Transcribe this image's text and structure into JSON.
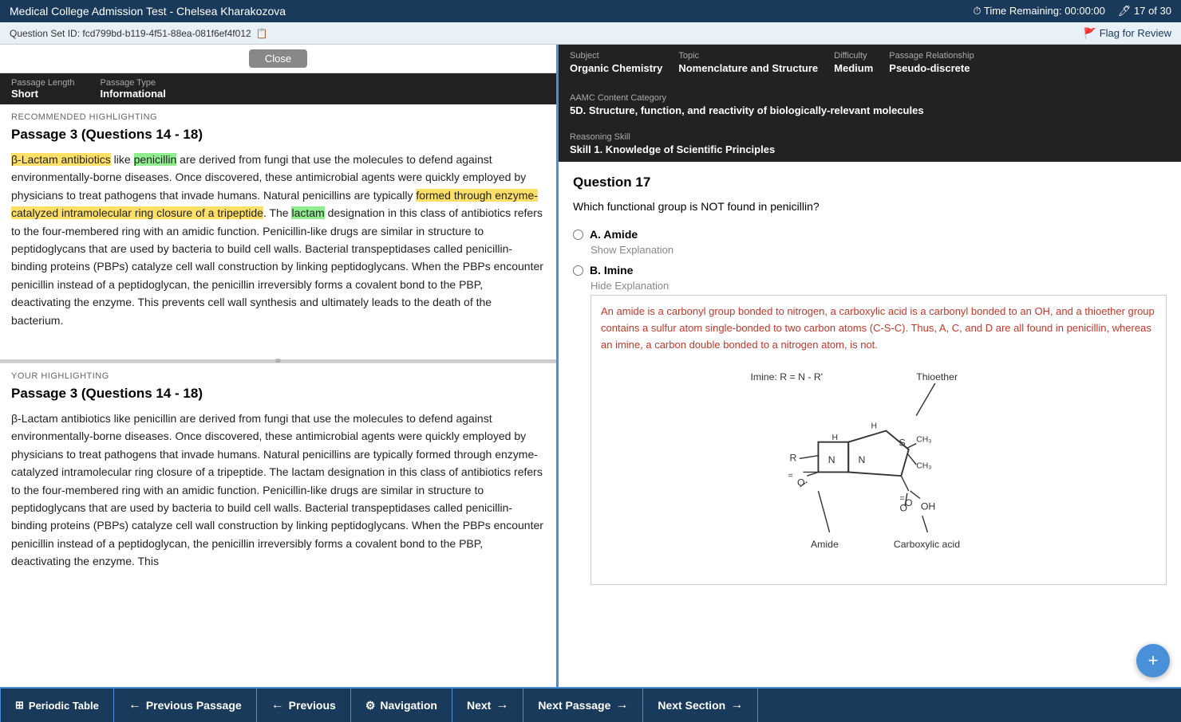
{
  "topBar": {
    "title": "Medical College Admission Test - Chelsea Kharakozova",
    "timeLabel": "Time Remaining:",
    "timeValue": "00:00:00",
    "questionCount": "17 of 30"
  },
  "qsetBar": {
    "idLabel": "Question Set ID: fcd799bd-b119-4f51-88ea-081f6ef4f012",
    "flagLabel": "Flag for Review"
  },
  "closeBtn": "Close",
  "leftMeta": {
    "passageLengthLabel": "Passage Length",
    "passageLengthValue": "Short",
    "passageTypeLabel": "Passage Type",
    "passageTypeValue": "Informational"
  },
  "rightMeta": {
    "subjectLabel": "Subject",
    "subjectValue": "Organic Chemistry",
    "topicLabel": "Topic",
    "topicValue": "Nomenclature and Structure",
    "difficultyLabel": "Difficulty",
    "difficultyValue": "Medium",
    "passageRelLabel": "Passage Relationship",
    "passageRelValue": "Pseudo-discrete",
    "aamcLabel": "AAMC Content Category",
    "aamcValue": "5D. Structure, function, and reactivity of biologically-relevant molecules",
    "reasoningLabel": "Reasoning Skill",
    "reasoningValue": "Skill 1. Knowledge of Scientific Principles"
  },
  "recHighlight": {
    "sectionLabel": "Recommended Highlighting",
    "passageTitle": "Passage 3 (Questions 14 - 18)",
    "paragraphParts": [
      {
        "text": "β-Lactam antibiotics",
        "style": "highlight-yellow"
      },
      {
        "text": " like "
      },
      {
        "text": "penicillin",
        "style": "highlight-green"
      },
      {
        "text": " are derived from fungi that use the molecules to defend against environmentally-borne diseases. Once discovered, these antimicrobial agents were quickly employed by physicians to treat pathogens that invade humans. Natural penicillins are typically "
      },
      {
        "text": "formed through enzyme-catalyzed intramolecular ring closure of a tripeptide",
        "style": "highlight-yellow"
      },
      {
        "text": ". The "
      },
      {
        "text": "lactam",
        "style": "highlight-green"
      },
      {
        "text": " designation in this class of antibiotics refers to the four-membered ring with an amidic function. Penicillin-like drugs are similar in structure to peptidoglycans that are used by bacteria to build cell walls. Bacterial transpeptidases called penicillin-binding proteins (PBPs) catalyze cell wall construction by linking peptidoglycans. When the PBPs encounter penicillin instead of a peptidoglycan, the penicillin irreversibly forms a covalent bond to the PBP, deactivating the enzyme. This prevents cell wall synthesis and ultimately leads to the death of the bacterium."
      }
    ]
  },
  "yourHighlight": {
    "sectionLabel": "Your Highlighting",
    "passageTitle": "Passage 3 (Questions 14 - 18)",
    "paragraph": "β-Lactam antibiotics like penicillin are derived from fungi that use the molecules to defend against environmentally-borne diseases. Once discovered, these antimicrobial agents were quickly employed by physicians to treat pathogens that invade humans. Natural penicillins are typically formed through enzyme-catalyzed intramolecular ring closure of a tripeptide. The lactam designation in this class of antibiotics refers to the four-membered ring with an amidic function. Penicillin-like drugs are similar in structure to peptidoglycans that are used by bacteria to build cell walls. Bacterial transpeptidases called penicillin-binding proteins (PBPs) catalyze cell wall construction by linking peptidoglycans. When the PBPs encounter penicillin instead of a peptidoglycan, the penicillin irreversibly forms a covalent bond to the PBP, deactivating the enzyme. This"
  },
  "question": {
    "number": "Question 17",
    "text": "Which functional group is NOT found in penicillin?",
    "options": [
      {
        "letter": "A",
        "label": "Amide",
        "showExp": "Show Explanation",
        "hasExp": false
      },
      {
        "letter": "B",
        "label": "Imine",
        "showExp": "Hide Explanation",
        "hasExp": true,
        "expText": "An amide is a carbonyl group bonded to nitrogen, a carboxylic acid is a carbonyl bonded to an OH, and a thioether group contains a sulfur atom single-bonded to two carbon atoms (C-S-C). Thus, A, C, and D are all found in penicillin, whereas an imine, a carbon double bonded to a nitrogen atom, is not."
      }
    ],
    "chemLabels": {
      "imine": "Imine: R = N - R'",
      "thioether": "Thioether",
      "amide": "Amide",
      "carboxylicAcid": "Carboxylic acid"
    }
  },
  "bottomNav": {
    "periodicTable": "Periodic Table",
    "previousPassage": "Previous Passage",
    "previous": "Previous",
    "navigation": "Navigation",
    "next": "Next",
    "nextPassage": "Next Passage",
    "nextSection": "Next Section"
  }
}
